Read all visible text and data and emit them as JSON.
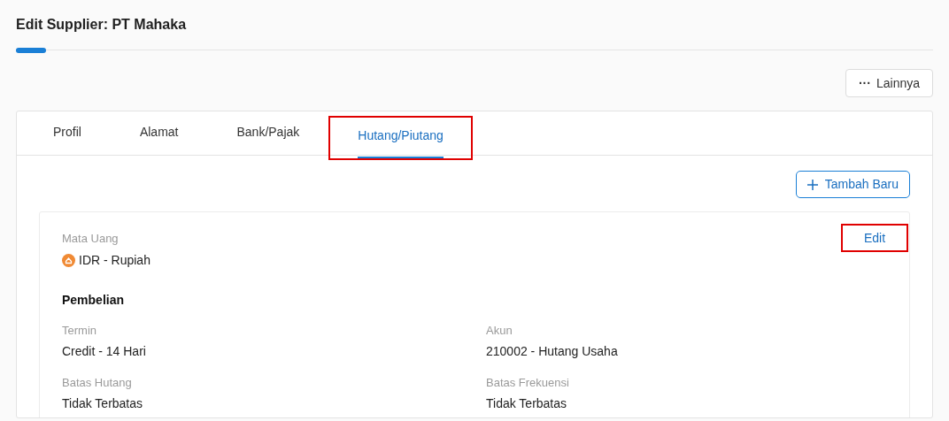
{
  "page": {
    "title": "Edit Supplier: PT Mahaka",
    "progress": {
      "level": 0.033
    }
  },
  "more_button": {
    "icon": "···",
    "label": "Lainnya"
  },
  "tabs": [
    {
      "label": "Profil",
      "selected": false,
      "highlighted": false
    },
    {
      "label": "Alamat",
      "selected": false,
      "highlighted": false
    },
    {
      "label": "Bank/Pajak",
      "selected": false,
      "highlighted": false
    },
    {
      "label": "Hutang/Piutang",
      "selected": true,
      "highlighted": true
    }
  ],
  "add_button": {
    "label": "Tambah Baru"
  },
  "currency_card": {
    "label": "Mata Uang",
    "value": "IDR - Rupiah",
    "edit_button": {
      "label": "Edit",
      "highlighted": true
    },
    "section_title": "Pembelian",
    "fields": [
      {
        "label": "Termin",
        "value": "Credit - 14 Hari"
      },
      {
        "label": "Akun",
        "value": "210002 - Hutang Usaha"
      },
      {
        "label": "Batas Hutang",
        "value": "Tidak Terbatas"
      },
      {
        "label": "Batas Frekuensi",
        "value": "Tidak Terbatas"
      }
    ]
  }
}
